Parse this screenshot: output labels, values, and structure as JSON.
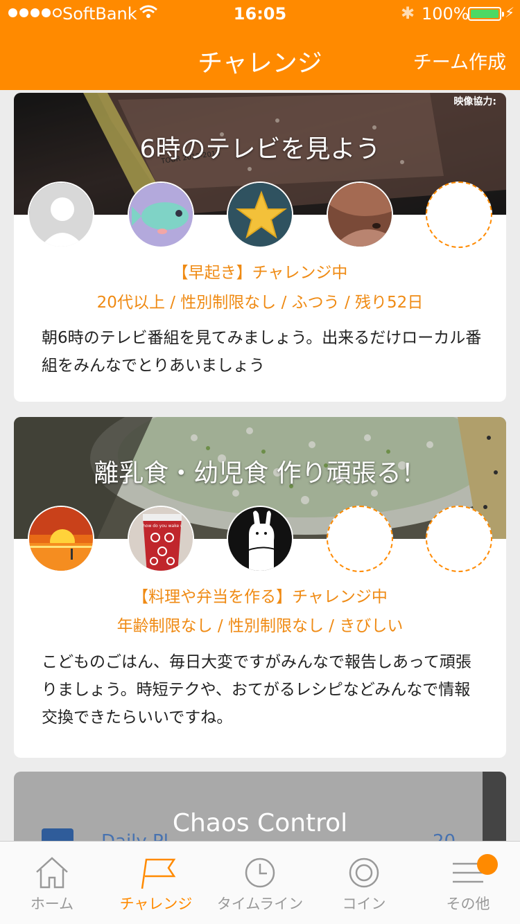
{
  "status": {
    "carrier": "SoftBank",
    "time": "16:05",
    "battery": "100%"
  },
  "nav": {
    "title": "チャレンジ",
    "action": "チーム作成"
  },
  "cards": [
    {
      "title": "6時のテレビを見よう",
      "category": "【早起き】チャレンジ中",
      "conditions": "20代以上 / 性別制限なし / ふつう / 残り52日",
      "description": "朝6時のテレビ番組を見てみましょう。出来るだけローカル番組をみんなでとりあいましょう",
      "banner_text": "映像協力:",
      "banner_text2": "TOUR 2012-2013"
    },
    {
      "title": "離乳食・幼児食 作り頑張る！",
      "category": "【料理や弁当を作る】チャレンジ中",
      "conditions": "年齢制限なし / 性別制限なし / きびしい",
      "description": "こどものごはん、毎日大変ですがみんなで報告しあって頑張りましょう。時短テクや、おてがるレシピなどみんなで情報交換できたらいいですね。",
      "cup_text": "how do you wake up"
    },
    {
      "title": "Chaos  Control",
      "peek_left": "Daily Pl",
      "peek_right": "20"
    }
  ],
  "tabs": [
    {
      "label": "ホーム",
      "icon": "home-icon"
    },
    {
      "label": "チャレンジ",
      "icon": "flag-icon"
    },
    {
      "label": "タイムライン",
      "icon": "clock-icon"
    },
    {
      "label": "コイン",
      "icon": "coin-icon"
    },
    {
      "label": "その他",
      "icon": "menu-icon"
    }
  ],
  "colors": {
    "accent": "#ff8a00",
    "meta": "#ef8a13"
  }
}
